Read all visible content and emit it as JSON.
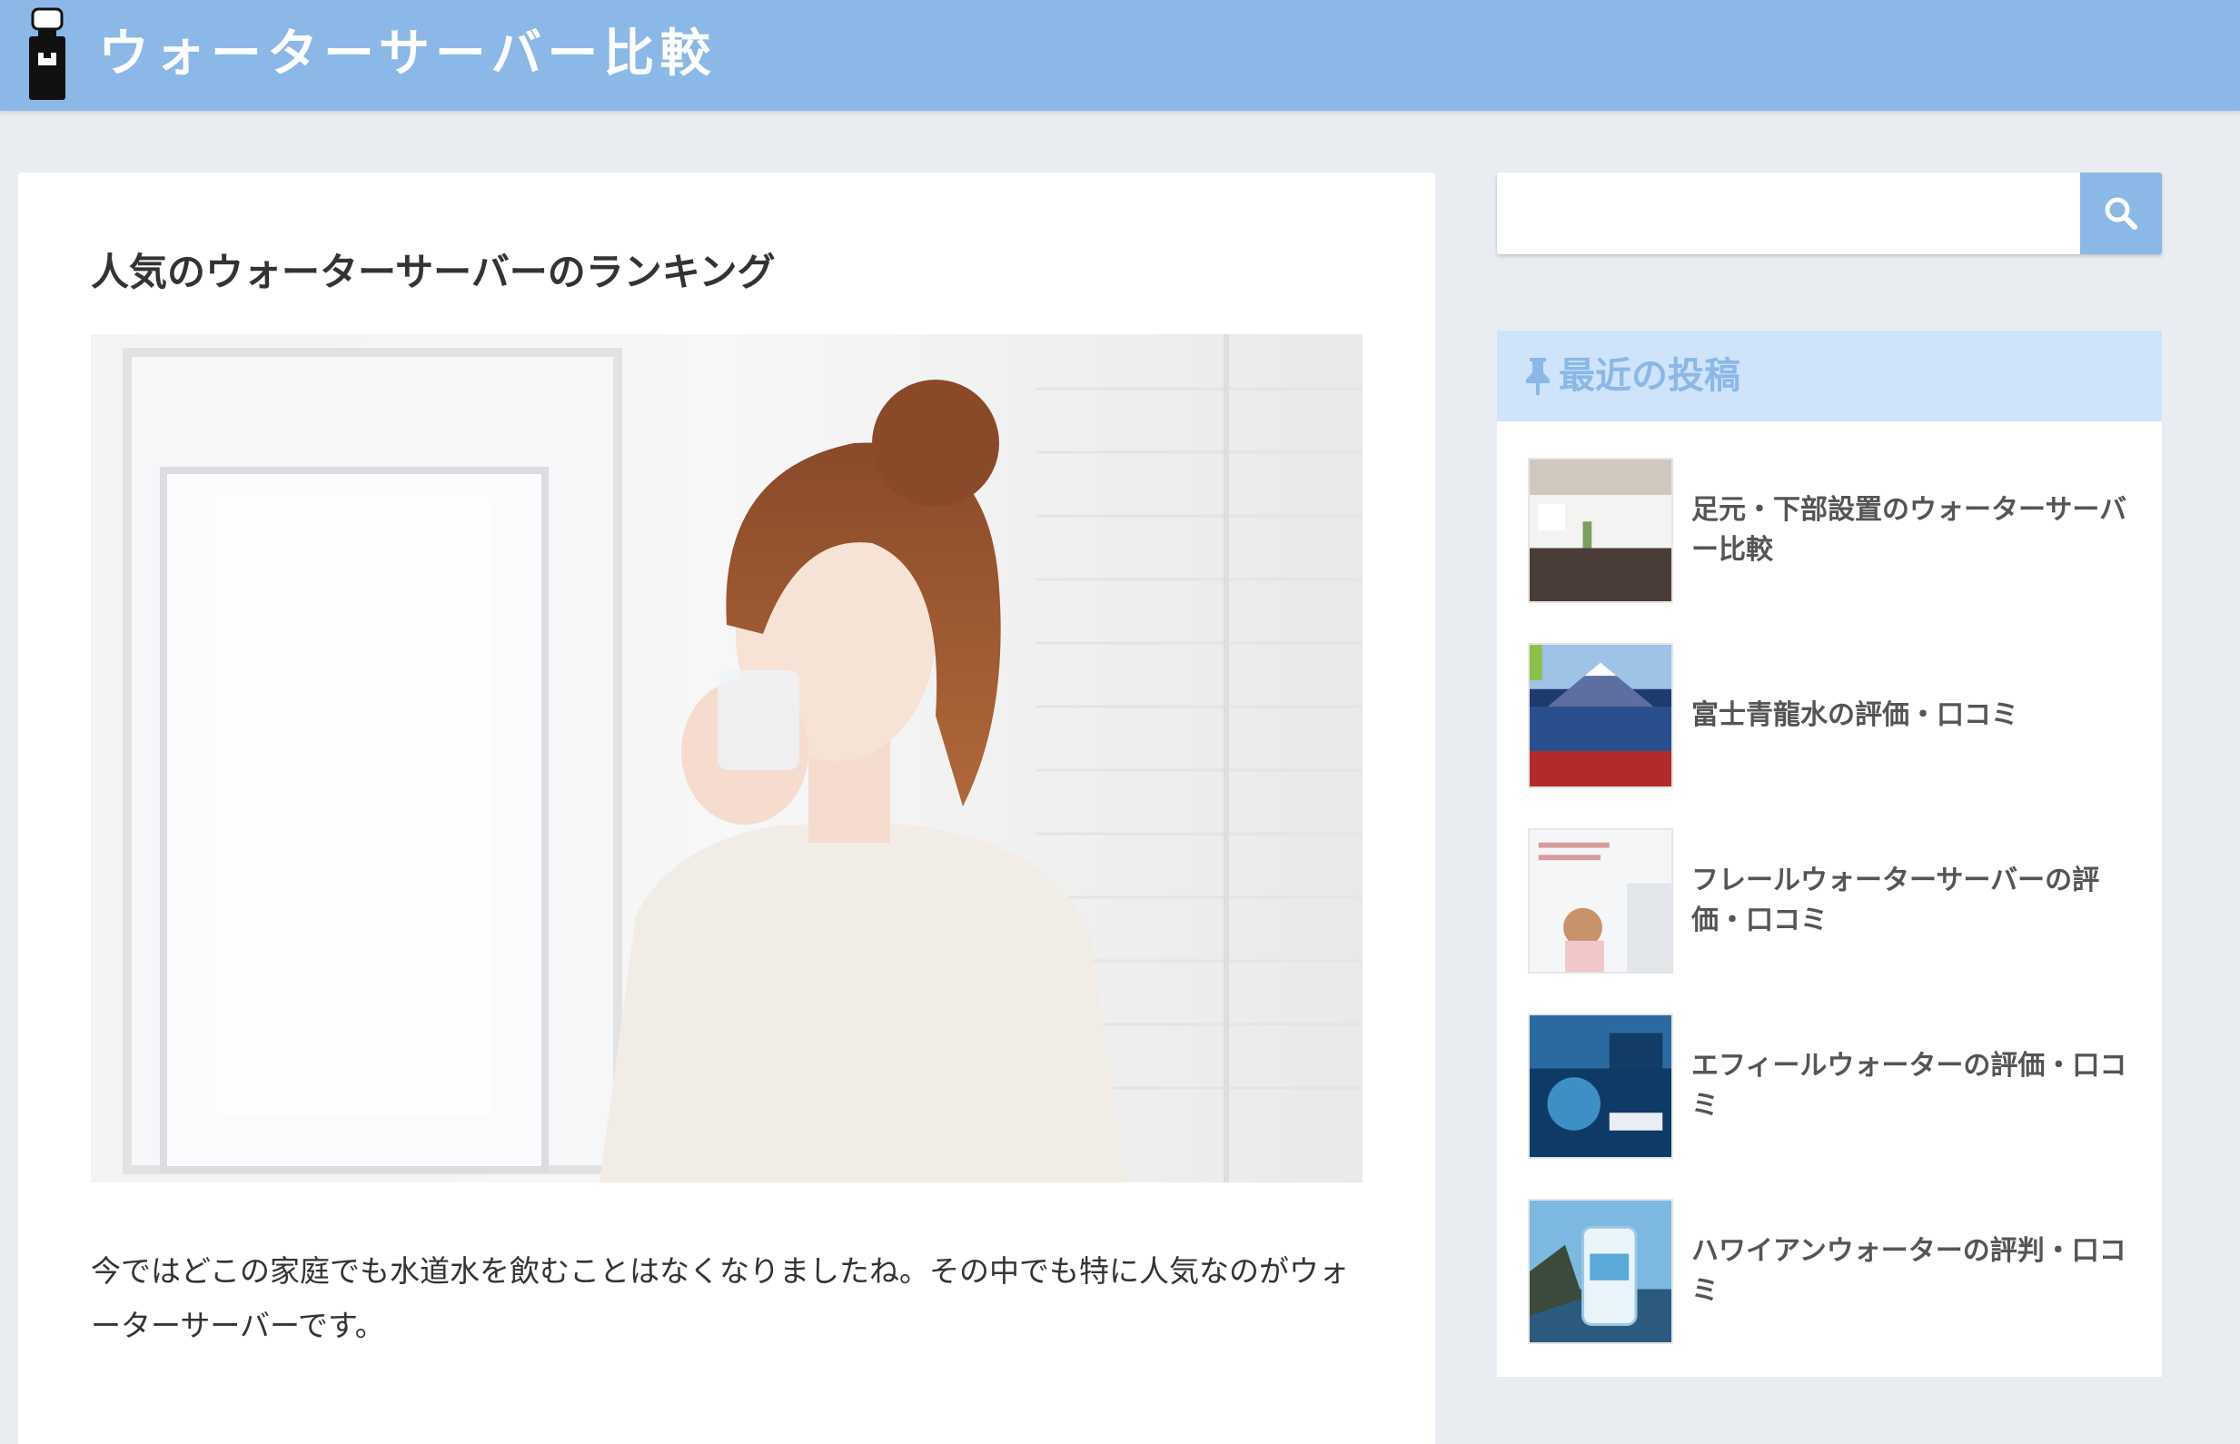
{
  "header": {
    "site_title": "ウォーターサーバー比較"
  },
  "article": {
    "title": "人気のウォーターサーバーのランキング",
    "body": "今ではどこの家庭でも水道水を飲むことはなくなりましたね。その中でも特に人気なのがウォーターサーバーです。"
  },
  "search": {
    "placeholder": "",
    "button_icon": "search-icon"
  },
  "widget": {
    "title": "最近の投稿",
    "title_icon": "pushpin-icon",
    "posts": [
      {
        "title": "足元・下部設置のウォーターサーバー比較"
      },
      {
        "title": "富士青龍水の評価・口コミ"
      },
      {
        "title": "フレールウォーターサーバーの評価・口コミ"
      },
      {
        "title": "エフィールウォーターの評価・口コミ"
      },
      {
        "title": "ハワイアンウォーターの評判・口コミ"
      }
    ]
  },
  "colors": {
    "header_bg": "#8bb8e6",
    "page_bg": "#e9edf2",
    "widget_header_bg": "#cfe3fb",
    "accent": "#8bb8e6"
  }
}
